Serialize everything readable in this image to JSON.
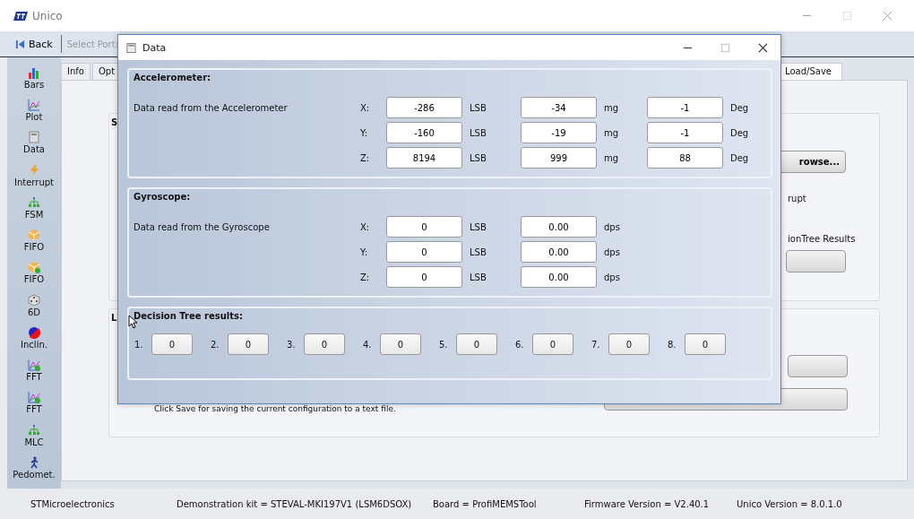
{
  "main_window": {
    "title": "Unico"
  },
  "toolbar": {
    "back": "Back",
    "port_label": "Select Port:"
  },
  "sidebar": {
    "items": [
      {
        "label": "Bars"
      },
      {
        "label": "Plot"
      },
      {
        "label": "Data"
      },
      {
        "label": "Interrupt"
      },
      {
        "label": "FSM"
      },
      {
        "label": "FIFO"
      },
      {
        "label": "FIFO"
      },
      {
        "label": "6D"
      },
      {
        "label": "Inclin."
      },
      {
        "label": "FFT"
      },
      {
        "label": "FFT"
      },
      {
        "label": "MLC"
      },
      {
        "label": "Pedomet."
      }
    ]
  },
  "tabs": [
    {
      "label": "Info",
      "selected": false
    },
    {
      "label": "Opt",
      "selected": false
    },
    {
      "label": "Load/Save",
      "selected": true
    }
  ],
  "panel": {
    "groups": [
      {
        "title": "S",
        "browse_button": "rowse...",
        "texts": [
          "rupt",
          "ionTree Results"
        ]
      },
      {
        "title": "L",
        "note": "Click Save for saving the current configuration to a text file."
      }
    ]
  },
  "dialog": {
    "title": "Data",
    "sections": [
      {
        "title": "Accelerometer:",
        "description": "Data read from the Accelerometer",
        "rows": [
          {
            "axis": "X:",
            "cells": [
              {
                "value": "-286",
                "unit": "LSB"
              },
              {
                "value": "-34",
                "unit": "mg"
              },
              {
                "value": "-1",
                "unit": "Deg"
              }
            ]
          },
          {
            "axis": "Y:",
            "cells": [
              {
                "value": "-160",
                "unit": "LSB"
              },
              {
                "value": "-19",
                "unit": "mg"
              },
              {
                "value": "-1",
                "unit": "Deg"
              }
            ]
          },
          {
            "axis": "Z:",
            "cells": [
              {
                "value": "8194",
                "unit": "LSB"
              },
              {
                "value": "999",
                "unit": "mg"
              },
              {
                "value": "88",
                "unit": "Deg"
              }
            ]
          }
        ]
      },
      {
        "title": "Gyroscope:",
        "description": "Data read from the Gyroscope",
        "rows": [
          {
            "axis": "X:",
            "cells": [
              {
                "value": "0",
                "unit": "LSB"
              },
              {
                "value": "0.00",
                "unit": "dps"
              }
            ]
          },
          {
            "axis": "Y:",
            "cells": [
              {
                "value": "0",
                "unit": "LSB"
              },
              {
                "value": "0.00",
                "unit": "dps"
              }
            ]
          },
          {
            "axis": "Z:",
            "cells": [
              {
                "value": "0",
                "unit": "LSB"
              },
              {
                "value": "0.00",
                "unit": "dps"
              }
            ]
          }
        ]
      }
    ],
    "decision_tree": {
      "title": "Decision Tree results:",
      "results": [
        {
          "label": "1.",
          "value": "0"
        },
        {
          "label": "2.",
          "value": "0"
        },
        {
          "label": "3.",
          "value": "0"
        },
        {
          "label": "4.",
          "value": "0"
        },
        {
          "label": "5.",
          "value": "0"
        },
        {
          "label": "6.",
          "value": "0"
        },
        {
          "label": "7.",
          "value": "0"
        },
        {
          "label": "8.",
          "value": "0"
        }
      ]
    }
  },
  "status_bar": [
    "STMicroelectronics",
    "Demonstration kit = STEVAL-MKI197V1 (LSM6DSOX)",
    "Board = ProfiMEMSTool",
    "Firmware Version = V2.40.1",
    "Unico Version = 8.0.1.0"
  ]
}
